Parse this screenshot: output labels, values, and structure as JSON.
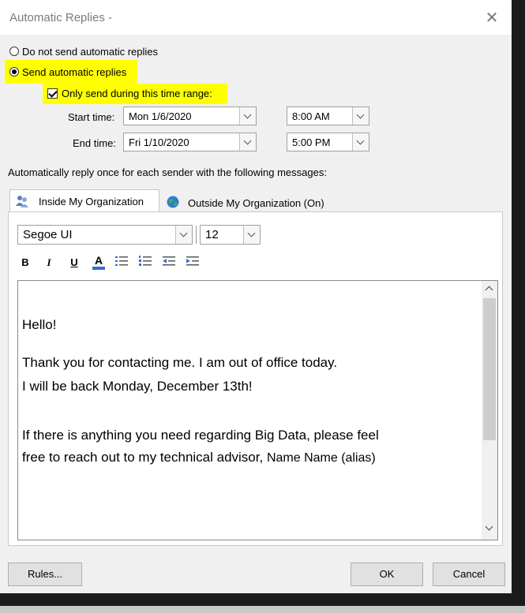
{
  "window": {
    "title": "Automatic Replies -"
  },
  "options": {
    "do_not_send": "Do not send automatic replies",
    "send": "Send automatic replies",
    "time_range": "Only send during this time range:"
  },
  "schedule": {
    "start_label": "Start time:",
    "start_date": "Mon 1/6/2020",
    "start_time": "8:00 AM",
    "end_label": "End time:",
    "end_date": "Fri 1/10/2020",
    "end_time": "5:00 PM"
  },
  "instruction": "Automatically reply once for each sender with the following messages:",
  "tabs": [
    {
      "label": "Inside My Organization",
      "icon": "people-icon"
    },
    {
      "label": "Outside My Organization (On)",
      "icon": "globe-icon"
    }
  ],
  "toolbar": {
    "font": "Segoe UI",
    "size": "12",
    "bold": "B",
    "italic": "I",
    "underline": "U",
    "font_color": "A"
  },
  "message": {
    "line1": "Hello!",
    "line2": "Thank you for contacting me. I am out of office today.",
    "line3": "I will be back Monday, December 13th!",
    "line4": "If there is anything you need regarding Big Data, please feel",
    "line5a": "free to reach out to my technical advisor, ",
    "line5b": "Name Name (alias)"
  },
  "buttons": {
    "rules": "Rules...",
    "ok": "OK",
    "cancel": "Cancel"
  },
  "colors": {
    "highlight": "#ffff00",
    "font_color_bar": "#2f6fd1"
  }
}
